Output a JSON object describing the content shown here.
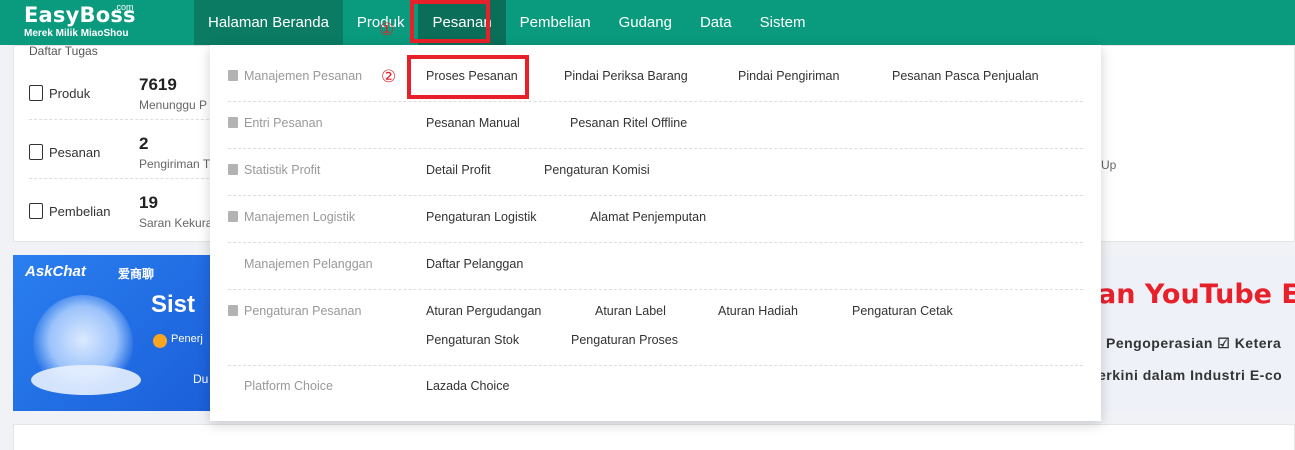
{
  "logo": {
    "name": "EasyBoss",
    "com": ".com",
    "subtitle": "Merek Milik MiaoShou"
  },
  "nav": [
    "Halaman Beranda",
    "Produk",
    "Pesanan",
    "Pembelian",
    "Gudang",
    "Data",
    "Sistem"
  ],
  "markers": {
    "one": "①",
    "two": "②"
  },
  "background": {
    "panel_title": "Daftar Tugas",
    "stats": [
      {
        "label": "Produk",
        "value": "7619",
        "caption": "Menunggu P"
      },
      {
        "label": "Pesanan",
        "value": "2",
        "caption": "Pengiriman T"
      },
      {
        "label": "Pembelian",
        "value": "19",
        "caption": "Saran Kekura"
      }
    ],
    "up_text": "Up",
    "banner_left": {
      "ask": "AskChat",
      "ask2": "爱商聊",
      "title": "Sist",
      "line": "Penerj",
      "line2": "Du"
    },
    "banner_right": {
      "title": "an YouTube E",
      "line2": "Pengoperasian  ☑ Ketera",
      "line3": "erkini dalam Industri E-co"
    }
  },
  "menu": {
    "categories": [
      {
        "label": "Manajemen Pesanan",
        "items": [
          "Proses Pesanan",
          "Pindai Periksa Barang",
          "Pindai Pengiriman",
          "Pesanan Pasca Penjualan"
        ]
      },
      {
        "label": "Entri Pesanan",
        "items": [
          "Pesanan Manual",
          "Pesanan Ritel Offline"
        ]
      },
      {
        "label": "Statistik Profit",
        "items": [
          "Detail Profit",
          "Pengaturan Komisi"
        ]
      },
      {
        "label": "Manajemen Logistik",
        "items": [
          "Pengaturan Logistik",
          "Alamat Penjemputan"
        ]
      },
      {
        "label": "Manajemen Pelanggan",
        "items": [
          "Daftar Pelanggan"
        ]
      },
      {
        "label": "Pengaturan Pesanan",
        "items": [
          "Aturan Pergudangan",
          "Aturan Label",
          "Aturan Hadiah",
          "Pengaturan Cetak",
          "Pengaturan Stok",
          "Pengaturan Proses"
        ]
      },
      {
        "label": "Platform Choice",
        "items": [
          "Lazada Choice"
        ]
      }
    ]
  },
  "colors": {
    "brand": "#0a9a7d",
    "highlight": "#e8202a"
  }
}
